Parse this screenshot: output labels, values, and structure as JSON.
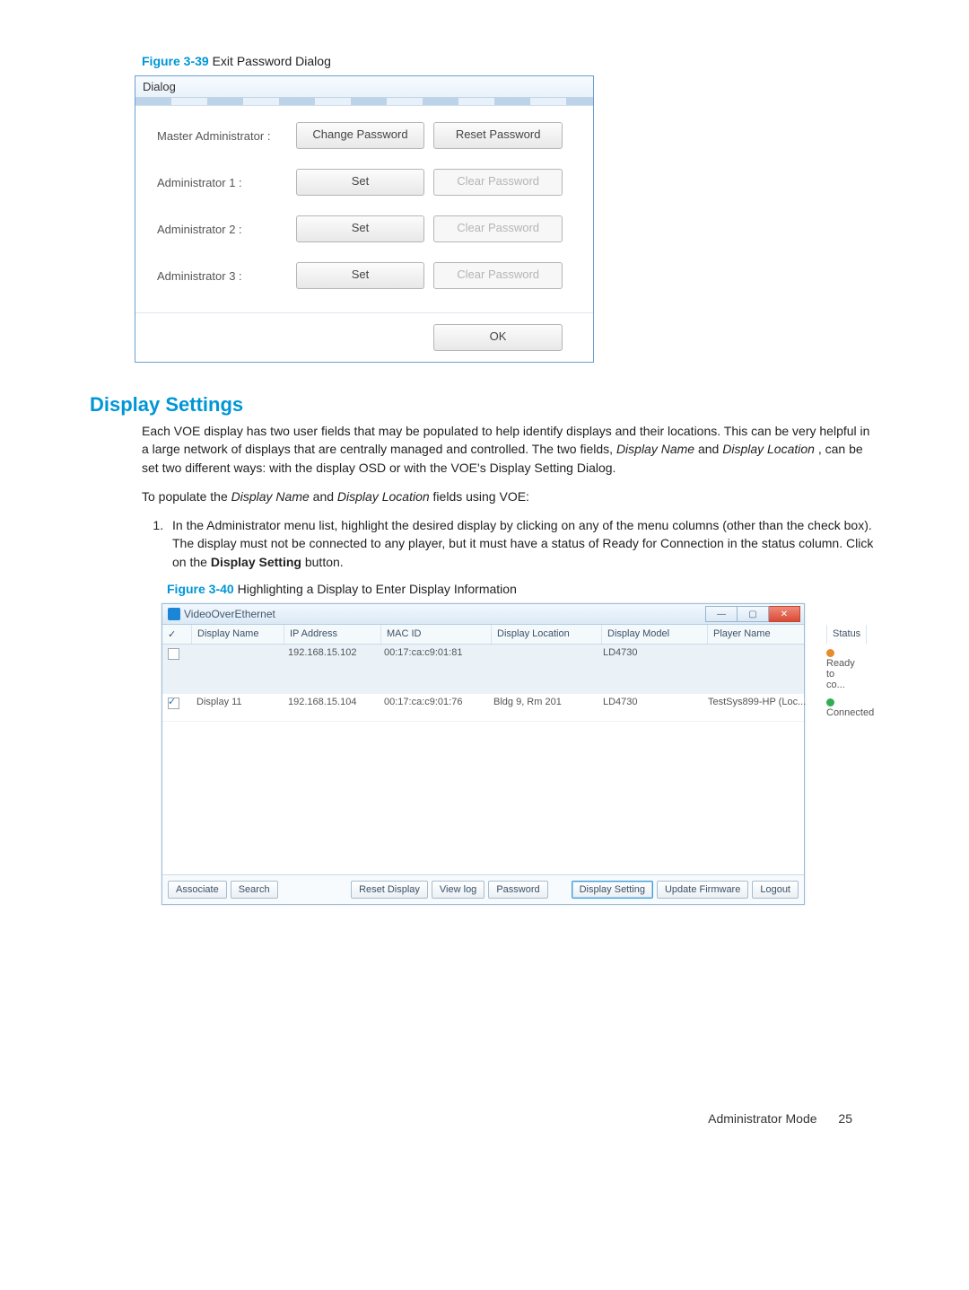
{
  "figure39": {
    "label": "Figure 3-39",
    "title": "Exit Password Dialog",
    "dialog_title": "Dialog",
    "rows": [
      {
        "label": "Master Administrator :",
        "btn1": "Change Password",
        "btn2": "Reset Password",
        "btn2_enabled": true
      },
      {
        "label": "Administrator 1 :",
        "btn1": "Set",
        "btn2": "Clear Password",
        "btn2_enabled": false
      },
      {
        "label": "Administrator 2 :",
        "btn1": "Set",
        "btn2": "Clear Password",
        "btn2_enabled": false
      },
      {
        "label": "Administrator 3 :",
        "btn1": "Set",
        "btn2": "Clear Password",
        "btn2_enabled": false
      }
    ],
    "ok": "OK"
  },
  "section_title": "Display Settings",
  "para1_a": "Each VOE display has two user fields that may be populated to help identify displays and their locations. This can be very helpful in a large network of displays that are centrally managed and controlled. The two fields, ",
  "para1_dn": "Display Name",
  "para1_b": " and ",
  "para1_dl": "Display Location",
  "para1_c": ", can be set two different ways: with the display OSD or with the VOE's Display Setting Dialog.",
  "para2_a": "To populate the ",
  "para2_b": " and ",
  "para2_c": " fields using VOE:",
  "step1_a": "In the Administrator menu list, highlight the desired display by clicking on any of the menu columns (other than the check box). The display must not be connected to any player, but it must have a status of ",
  "step1_ready": "Ready for Connection",
  "step1_b": " in the status column. Click on the ",
  "step1_btn": "Display Setting",
  "step1_c": " button.",
  "figure40": {
    "label": "Figure 3-40",
    "title": "Highlighting a Display to Enter Display Information",
    "window_title": "VideoOverEthernet",
    "min_sym": "—",
    "max_sym": "▢",
    "close_sym": "✕",
    "headers": {
      "chk": "✓",
      "name": "Display Name",
      "ip": "IP Address",
      "mac": "MAC ID",
      "loc": "Display Location",
      "model": "Display Model",
      "player": "Player Name",
      "status": "Status"
    },
    "rows": [
      {
        "chk": false,
        "name": "",
        "ip": "192.168.15.102",
        "mac": "00:17:ca:c9:01:81",
        "loc": "",
        "model": "LD4730",
        "player": "",
        "status": "Ready to co...",
        "dot": "orange",
        "selected": true
      },
      {
        "chk": true,
        "name": "Display 11",
        "ip": "192.168.15.104",
        "mac": "00:17:ca:c9:01:76",
        "loc": "Bldg 9, Rm 201",
        "model": "LD4730",
        "player": "TestSys899-HP (Loc...",
        "status": "Connected",
        "dot": "green",
        "selected": false
      }
    ],
    "buttons": {
      "associate": "Associate",
      "search": "Search",
      "reset": "Reset Display",
      "viewlog": "View log",
      "password": "Password",
      "display_setting": "Display Setting",
      "update_fw": "Update Firmware",
      "logout": "Logout"
    }
  },
  "footer": {
    "label": "Administrator Mode",
    "page": "25"
  }
}
